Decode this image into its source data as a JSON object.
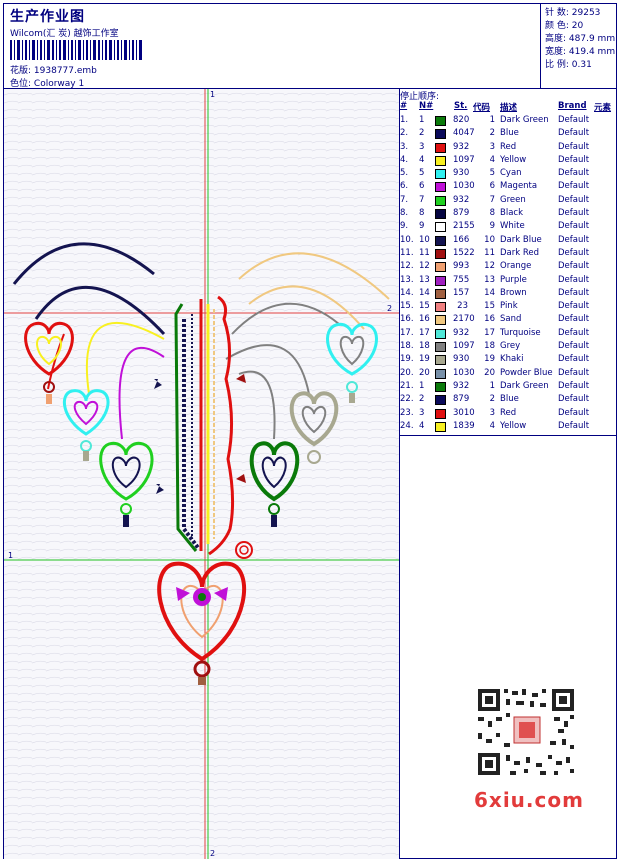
{
  "header": {
    "title": "生产作业图",
    "studio": "Wilcom(汇 炭) 越饰工作室",
    "file_label": "花版:",
    "file_value": "1938777.emb",
    "colorway_label": "色位:",
    "colorway_value": "Colorway 1"
  },
  "stats": [
    {
      "label": "针 数:",
      "value": "29253"
    },
    {
      "label": "颜 色:",
      "value": "20"
    },
    {
      "label": "高度:",
      "value": "487.9 mm"
    },
    {
      "label": "宽度:",
      "value": "419.4 mm"
    },
    {
      "label": "比 例:",
      "value": "0.31"
    }
  ],
  "canvas": {
    "marker_1": "1",
    "marker_2": "2"
  },
  "sequence": {
    "title": "停止顺序:",
    "columns": [
      "#",
      "N#",
      "St.",
      "代码",
      "描述",
      "Brand",
      "元素"
    ],
    "rows": [
      {
        "n": "1.",
        "nn": "1",
        "color": "#0a7a0a",
        "st": "820",
        "code": "1",
        "desc": "Dark Green",
        "brand": "Default"
      },
      {
        "n": "2.",
        "nn": "2",
        "color": "#0a0a5a",
        "st": "4047",
        "code": "2",
        "desc": "Blue",
        "brand": "Default"
      },
      {
        "n": "3.",
        "nn": "3",
        "color": "#e01010",
        "st": "932",
        "code": "3",
        "desc": "Red",
        "brand": "Default"
      },
      {
        "n": "4.",
        "nn": "4",
        "color": "#f8f020",
        "st": "1097",
        "code": "4",
        "desc": "Yellow",
        "brand": "Default"
      },
      {
        "n": "5.",
        "nn": "5",
        "color": "#30f0f0",
        "st": "930",
        "code": "5",
        "desc": "Cyan",
        "brand": "Default"
      },
      {
        "n": "6.",
        "nn": "6",
        "color": "#c010d8",
        "st": "1030",
        "code": "6",
        "desc": "Magenta",
        "brand": "Default"
      },
      {
        "n": "7.",
        "nn": "7",
        "color": "#20d020",
        "st": "932",
        "code": "7",
        "desc": "Green",
        "brand": "Default"
      },
      {
        "n": "8.",
        "nn": "8",
        "color": "#050540",
        "st": "879",
        "code": "8",
        "desc": "Black",
        "brand": "Default"
      },
      {
        "n": "9.",
        "nn": "9",
        "color": "#ffffff",
        "st": "2155",
        "code": "9",
        "desc": "White",
        "brand": "Default"
      },
      {
        "n": "10.",
        "nn": "10",
        "color": "#141450",
        "st": "166",
        "code": "10",
        "desc": "Dark Blue",
        "brand": "Default"
      },
      {
        "n": "11.",
        "nn": "11",
        "color": "#a01010",
        "st": "1522",
        "code": "11",
        "desc": "Dark Red",
        "brand": "Default"
      },
      {
        "n": "12.",
        "nn": "12",
        "color": "#f0a070",
        "st": "993",
        "code": "12",
        "desc": "Orange",
        "brand": "Default"
      },
      {
        "n": "13.",
        "nn": "13",
        "color": "#a020c0",
        "st": "755",
        "code": "13",
        "desc": "Purple",
        "brand": "Default"
      },
      {
        "n": "14.",
        "nn": "14",
        "color": "#a06040",
        "st": "157",
        "code": "14",
        "desc": "Brown",
        "brand": "Default"
      },
      {
        "n": "15.",
        "nn": "15",
        "color": "#f08080",
        "st": "23",
        "code": "15",
        "desc": "Pink",
        "brand": "Default"
      },
      {
        "n": "16.",
        "nn": "16",
        "color": "#f0c880",
        "st": "2170",
        "code": "16",
        "desc": "Sand",
        "brand": "Default"
      },
      {
        "n": "17.",
        "nn": "17",
        "color": "#50e8d8",
        "st": "932",
        "code": "17",
        "desc": "Turquoise",
        "brand": "Default"
      },
      {
        "n": "18.",
        "nn": "18",
        "color": "#808080",
        "st": "1097",
        "code": "18",
        "desc": "Grey",
        "brand": "Default"
      },
      {
        "n": "19.",
        "nn": "19",
        "color": "#a8a890",
        "st": "930",
        "code": "19",
        "desc": "Khaki",
        "brand": "Default"
      },
      {
        "n": "20.",
        "nn": "20",
        "color": "#7890a8",
        "st": "1030",
        "code": "20",
        "desc": "Powder Blue",
        "brand": "Default"
      },
      {
        "n": "21.",
        "nn": "1",
        "color": "#0a7a0a",
        "st": "932",
        "code": "1",
        "desc": "Dark Green",
        "brand": "Default"
      },
      {
        "n": "22.",
        "nn": "2",
        "color": "#0a0a5a",
        "st": "879",
        "code": "2",
        "desc": "Blue",
        "brand": "Default"
      },
      {
        "n": "23.",
        "nn": "3",
        "color": "#e01010",
        "st": "3010",
        "code": "3",
        "desc": "Red",
        "brand": "Default"
      },
      {
        "n": "24.",
        "nn": "4",
        "color": "#f8f020",
        "st": "1839",
        "code": "4",
        "desc": "Yellow",
        "brand": "Default"
      }
    ]
  },
  "watermark": {
    "brand": "6xiu.com"
  }
}
